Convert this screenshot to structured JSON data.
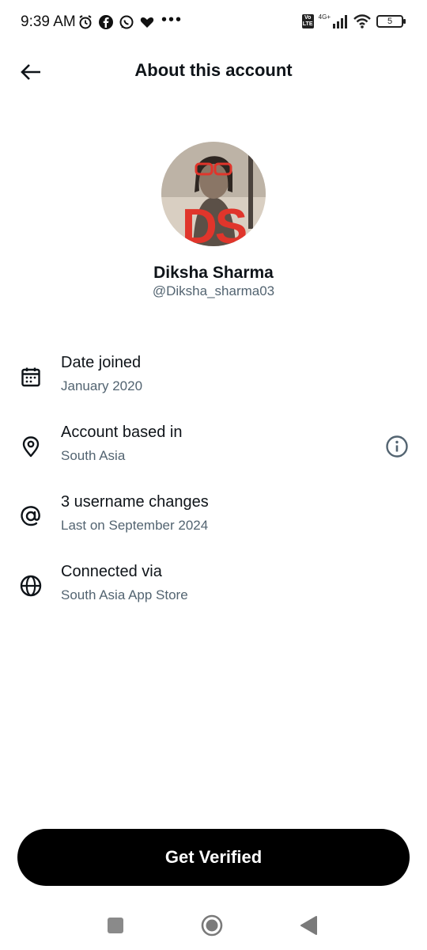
{
  "status_bar": {
    "time": "9:39 AM",
    "left_icons": [
      "alarm-icon",
      "facebook-icon",
      "whatsapp-icon",
      "heart-icon"
    ],
    "more": "•••",
    "volte": "Vo LTE",
    "network": "4G+",
    "battery": "5"
  },
  "header": {
    "title": "About this account",
    "back_icon": "back-arrow-icon"
  },
  "profile": {
    "display_name": "Diksha Sharma",
    "handle": "@Diksha_sharma03",
    "avatar_text": "DS"
  },
  "info_rows": [
    {
      "icon": "calendar-icon",
      "label": "Date joined",
      "value": "January 2020"
    },
    {
      "icon": "location-pin-icon",
      "label": "Account based in",
      "value": "South Asia",
      "action_icon": "info-icon"
    },
    {
      "icon": "at-sign-icon",
      "label": "3 username changes",
      "value": "Last on September 2024"
    },
    {
      "icon": "globe-icon",
      "label": "Connected via",
      "value": "South Asia App Store"
    }
  ],
  "verify_button": {
    "label": "Get Verified"
  },
  "nav_bar": [
    "recents-icon",
    "home-icon",
    "back-icon"
  ],
  "colors": {
    "text": "#0f1419",
    "secondary": "#536471",
    "button_bg": "#000000",
    "button_text": "#ffffff",
    "avatar_red": "#e0352b"
  }
}
